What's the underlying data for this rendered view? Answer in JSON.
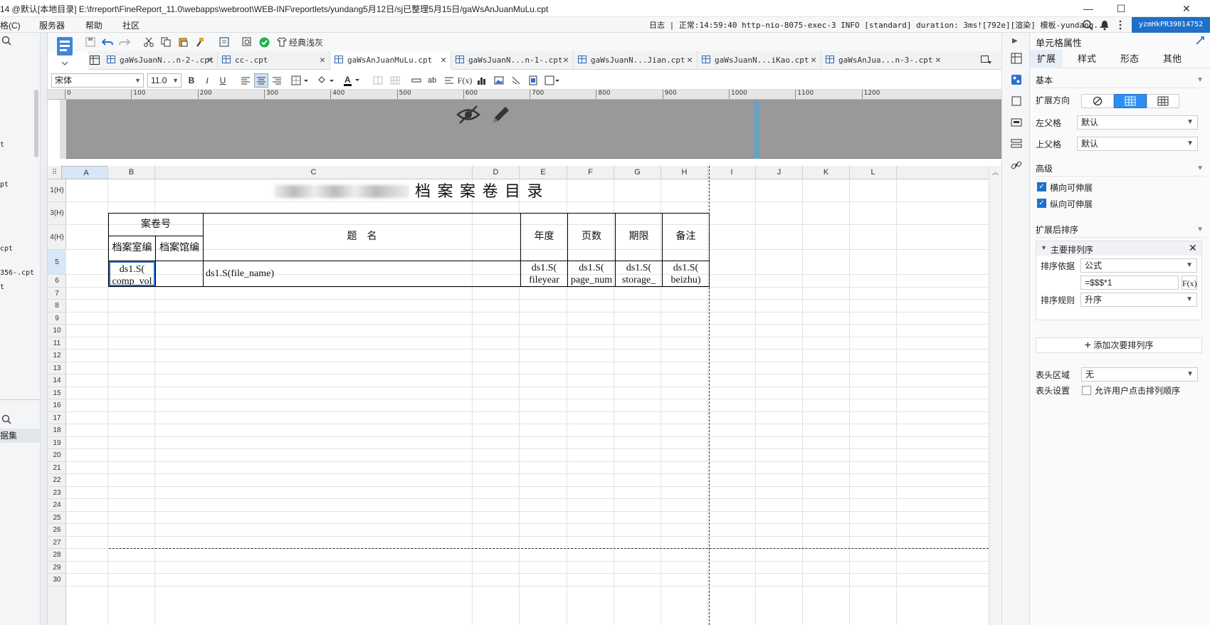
{
  "window": {
    "title": "14 @默认[本地目录]    E:\\frreport\\FineReport_11.0\\webapps\\webroot\\WEB-INF\\reportlets/yundang5月12日/sj已整理5月15日/gaWsAnJuanMuLu.cpt",
    "minimize": "—",
    "maximize": "☐",
    "close": "✕"
  },
  "menubar": {
    "items": [
      "格(C)",
      "服务器",
      "帮助",
      "社区"
    ],
    "log_text": "日志 | 正常:14:59:40 http-nio-8075-exec-3 INFO [standard] duration: 3ms![792e][渲染] 模板-yundang...",
    "user": "yzmHkPR39014752"
  },
  "left_panel": {
    "items": [
      "t",
      "pt",
      "cpt",
      "356-.cpt",
      "t"
    ],
    "dataset_label": "据集"
  },
  "toolbar": {
    "theme_label": "经典浅灰",
    "font_name": "宋体",
    "font_size": "11.0"
  },
  "tabs": [
    {
      "label": "gaWsJuanN...n-2-.cpt",
      "active": false
    },
    {
      "label": "cc-.cpt",
      "active": false
    },
    {
      "label": "gaWsAnJuanMuLu.cpt",
      "active": true
    },
    {
      "label": "gaWsJuanN...n-1-.cpt",
      "active": false
    },
    {
      "label": "gaWsJuanN...Jian.cpt",
      "active": false
    },
    {
      "label": "gaWsJuanN...iKao.cpt",
      "active": false
    },
    {
      "label": "gaWsAnJua...n-3-.cpt",
      "active": false
    }
  ],
  "ruler": {
    "marks": [
      "0",
      "100",
      "200",
      "300",
      "400",
      "500",
      "600",
      "700",
      "800",
      "900",
      "1000",
      "1100",
      "1200"
    ]
  },
  "sheet": {
    "columns": [
      "A",
      "B",
      "C",
      "D",
      "E",
      "F",
      "G",
      "H",
      "I",
      "J",
      "K",
      "L"
    ],
    "rows": [
      "1(H)",
      "3(H)",
      "4(H)",
      "5",
      "6",
      "7",
      "8",
      "9",
      "10",
      "11",
      "12",
      "13",
      "14",
      "15",
      "16",
      "17",
      "18",
      "19",
      "20",
      "21",
      "22",
      "23",
      "24",
      "25",
      "26",
      "27",
      "28",
      "29",
      "30"
    ],
    "title": "档 案 案 卷 目 录",
    "header_case_no": "案卷号",
    "header_room_no": "档案室编",
    "header_hall_no": "档案馆编",
    "header_title": "题　名",
    "header_year": "年度",
    "header_pages": "页数",
    "header_term": "期限",
    "header_note": "备注",
    "cell_a5": "ds1.S(\ncomp_vol",
    "cell_c5": "ds1.S(file_name)",
    "cell_d5": "ds1.S(\nfileyear",
    "cell_e5": "ds1.S(\npage_num",
    "cell_f5": "ds1.S(\nstorage_",
    "cell_g5": "ds1.S(\nbeizhu)"
  },
  "right_panel": {
    "title": "单元格属性",
    "tabs": [
      "扩展",
      "样式",
      "形态",
      "其他"
    ],
    "section_basic": "基本",
    "expand_direction": "扩展方向",
    "left_parent": "左父格",
    "left_parent_value": "默认",
    "top_parent": "上父格",
    "top_parent_value": "默认",
    "section_advanced": "高级",
    "horizontal_expand": "横向可伸展",
    "vertical_expand": "纵向可伸展",
    "section_sort": "扩展后排序",
    "primary_sort": "主要排列序",
    "sort_by": "排序依据",
    "sort_by_value": "公式",
    "formula": "=$$$*1",
    "sort_rule": "排序规则",
    "sort_rule_value": "升序",
    "add_secondary": "添加次要排列序",
    "header_area": "表头区域",
    "header_area_value": "无",
    "header_setting": "表头设置",
    "allow_user_sort": "允许用户点击排列顺序"
  }
}
